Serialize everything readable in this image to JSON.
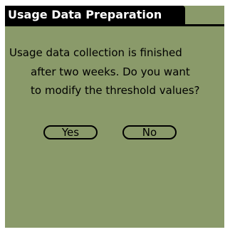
{
  "dialog": {
    "title": "Usage Data Preparation",
    "message_lines": [
      "Usage data collection is finished",
      "after two weeks.  Do you want",
      "to modify the threshold values?"
    ],
    "buttons": {
      "yes_label": "Yes",
      "no_label": "No"
    }
  }
}
